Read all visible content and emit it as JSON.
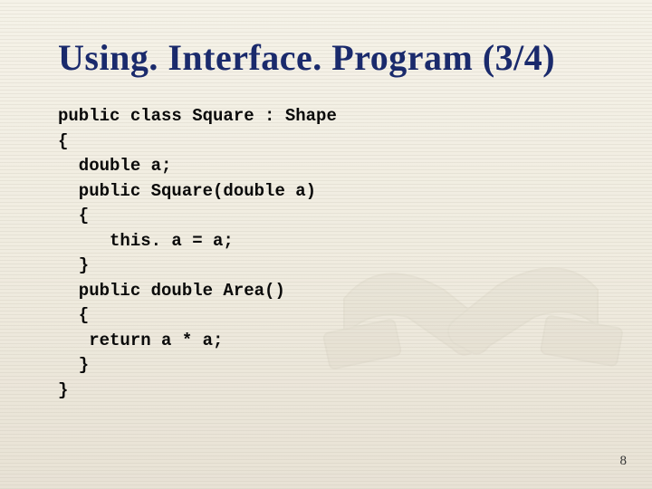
{
  "slide": {
    "title": "Using. Interface. Program (3/4)",
    "code": "public class Square : Shape\n{\n  double a;\n  public Square(double a)\n  {\n     this. a = a;\n  }\n  public double Area()\n  {\n   return a * a;\n  }\n}",
    "page_number": "8"
  }
}
